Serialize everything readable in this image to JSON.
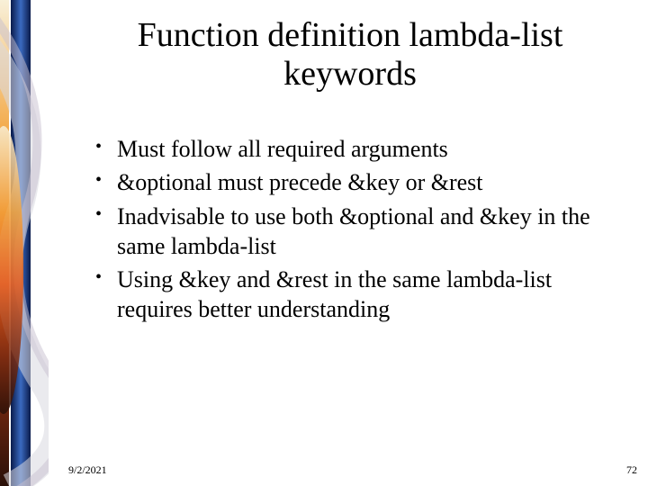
{
  "slide": {
    "title": "Function definition lambda-list keywords",
    "bullets": [
      "Must follow all required arguments",
      "&optional must precede &key or &rest",
      "Inadvisable to use both &optional and &key in the same lambda-list",
      "Using &key and &rest in the same lambda-list requires better understanding"
    ]
  },
  "footer": {
    "date": "9/2/2021",
    "page": "72"
  }
}
